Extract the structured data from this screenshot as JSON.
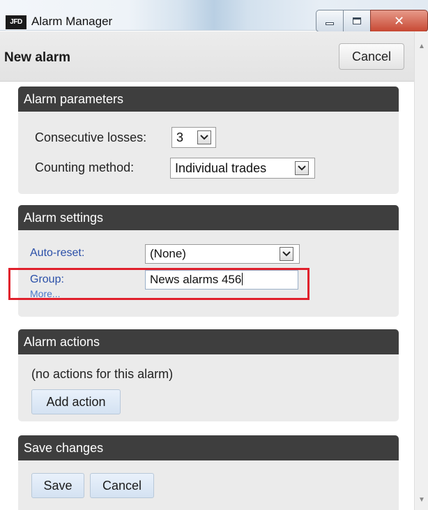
{
  "window": {
    "app_badge": "JFD",
    "title": "Alarm Manager"
  },
  "header": {
    "title": "New alarm",
    "cancel_label": "Cancel"
  },
  "alarm_parameters": {
    "heading": "Alarm parameters",
    "consecutive_losses_label": "Consecutive losses:",
    "consecutive_losses_value": "3",
    "counting_method_label": "Counting method:",
    "counting_method_value": "Individual trades"
  },
  "alarm_settings": {
    "heading": "Alarm settings",
    "auto_reset_label": "Auto-reset:",
    "auto_reset_value": "(None)",
    "group_label": "Group:",
    "group_value": "News alarms 456",
    "more_label": "More..."
  },
  "alarm_actions": {
    "heading": "Alarm actions",
    "empty_text": "(no actions for this alarm)",
    "add_action_label": "Add action"
  },
  "save_changes": {
    "heading": "Save changes",
    "save_label": "Save",
    "cancel_label": "Cancel"
  },
  "colors": {
    "section_header_bg": "#3e3e3e",
    "section_bg": "#ebebeb",
    "link_blue": "#2a4fa8",
    "highlight_red": "#e0202c",
    "button_blue": "#d4e2f2"
  },
  "icons": {
    "app_logo": "jfd-logo-icon",
    "minimize": "minimize-icon",
    "maximize": "maximize-icon",
    "close": "close-icon",
    "dropdown": "chevron-down-icon",
    "scroll_up": "scroll-up-arrow-icon",
    "scroll_down": "scroll-down-arrow-icon"
  }
}
